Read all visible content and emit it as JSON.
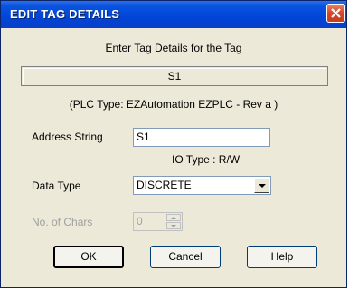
{
  "window": {
    "title": "EDIT TAG DETAILS",
    "close_icon": "close-icon"
  },
  "header": {
    "instruction": "Enter Tag Details for the Tag",
    "tag_name": "S1",
    "plc_type": "(PLC Type:  EZAutomation EZPLC  - Rev a )"
  },
  "form": {
    "address_label": "Address String",
    "address_value": "S1",
    "io_type": "IO Type : R/W",
    "data_type_label": "Data Type",
    "data_type_value": "DISCRETE",
    "chars_label": "No. of Chars",
    "chars_value": "0"
  },
  "buttons": {
    "ok": "OK",
    "cancel": "Cancel",
    "help": "Help"
  },
  "colors": {
    "titlebar": "#0045d8",
    "dialog_bg": "#ece9d8",
    "close_button": "#d6452a"
  }
}
